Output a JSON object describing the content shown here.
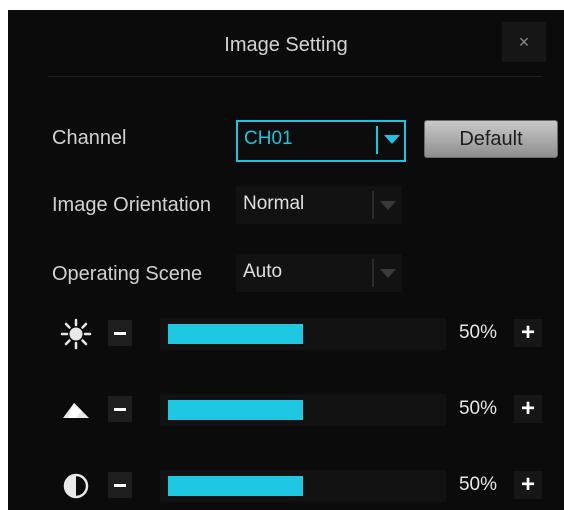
{
  "dialog": {
    "title": "Image Setting",
    "close_label": "×"
  },
  "channel": {
    "label": "Channel",
    "value": "CH01"
  },
  "default_button": "Default",
  "orientation": {
    "label": "Image Orientation",
    "value": "Normal"
  },
  "scene": {
    "label": "Operating Scene",
    "value": "Auto"
  },
  "sliders": [
    {
      "icon": "brightness-icon",
      "percent_text": "50%",
      "level": 0.5,
      "plus_label": "+"
    },
    {
      "icon": "contrast-icon",
      "percent_text": "50%",
      "level": 0.5,
      "plus_label": "+"
    },
    {
      "icon": "saturation-icon",
      "percent_text": "50%",
      "level": 0.5,
      "plus_label": "+"
    }
  ],
  "colors": {
    "accent": "#1ec8e2",
    "background": "#0b0b0b",
    "button": "#b5b5b5"
  }
}
